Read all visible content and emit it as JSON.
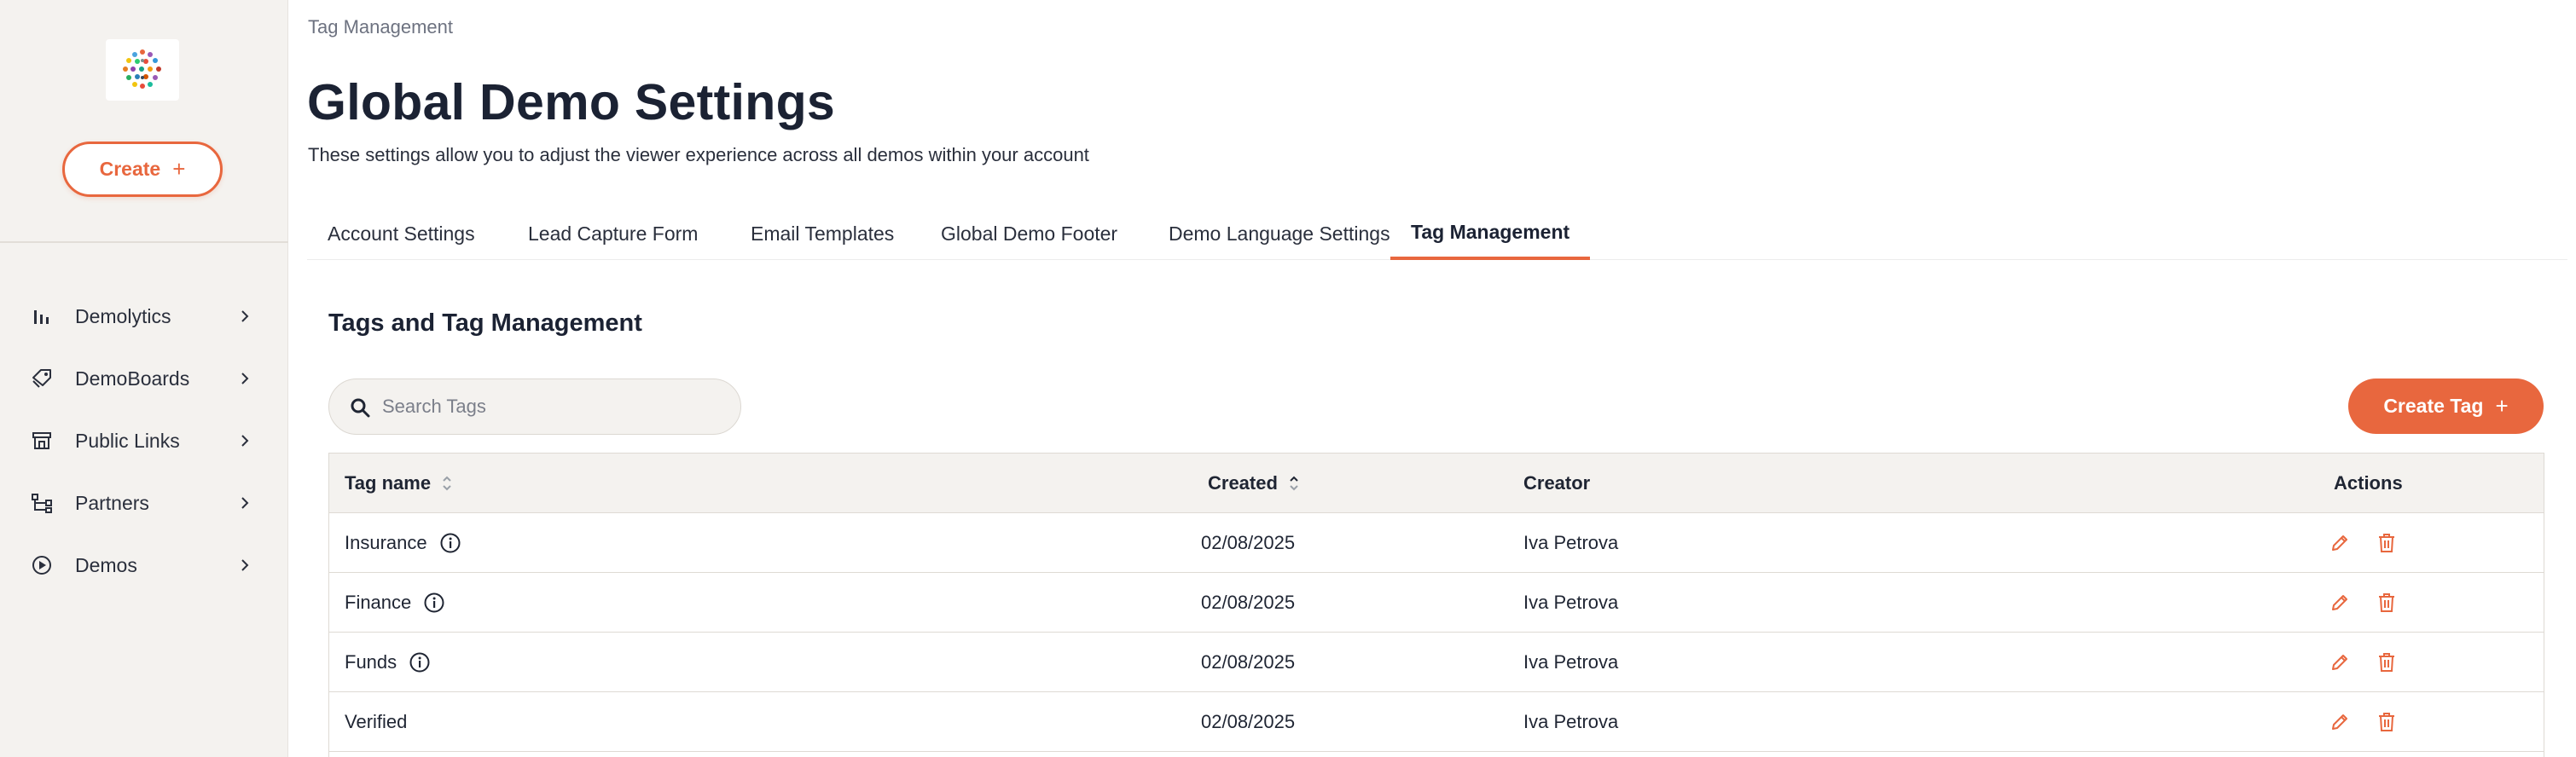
{
  "sidebar": {
    "create_label": "Create",
    "create_icon": "plus-icon",
    "items": [
      {
        "label": "Demolytics",
        "icon": "bar-chart-icon"
      },
      {
        "label": "DemoBoards",
        "icon": "tag-stack-icon"
      },
      {
        "label": "Public Links",
        "icon": "storefront-icon"
      },
      {
        "label": "Partners",
        "icon": "partner-network-icon"
      },
      {
        "label": "Demos",
        "icon": "play-circle-icon"
      }
    ]
  },
  "header": {
    "breadcrumb": "Tag Management",
    "title": "Global Demo Settings",
    "description": "These settings allow you to adjust the viewer experience across all demos within your account"
  },
  "tabs": [
    {
      "label": "Account Settings",
      "active": false
    },
    {
      "label": "Lead Capture Form",
      "active": false
    },
    {
      "label": "Email Templates",
      "active": false
    },
    {
      "label": "Global Demo Footer",
      "active": false
    },
    {
      "label": "Demo Language Settings",
      "active": false
    },
    {
      "label": "Tag Management",
      "active": true
    }
  ],
  "section": {
    "title": "Tags and Tag Management",
    "search_placeholder": "Search Tags",
    "create_tag_label": "Create Tag"
  },
  "table": {
    "columns": {
      "tag_name": "Tag name",
      "created": "Created",
      "creator": "Creator",
      "actions": "Actions"
    },
    "rows": [
      {
        "tag_name": "Insurance",
        "created": "02/08/2025",
        "creator": "Iva Petrova",
        "info": true
      },
      {
        "tag_name": "Finance",
        "created": "02/08/2025",
        "creator": "Iva Petrova",
        "info": true
      },
      {
        "tag_name": "Funds",
        "created": "02/08/2025",
        "creator": "Iva Petrova",
        "info": true
      },
      {
        "tag_name": "Verified",
        "created": "02/08/2025",
        "creator": "Iva Petrova",
        "info": false
      }
    ]
  },
  "colors": {
    "accent": "#e8673e",
    "sidebar_bg": "#f4f2ef",
    "text_dark": "#1b2233"
  }
}
